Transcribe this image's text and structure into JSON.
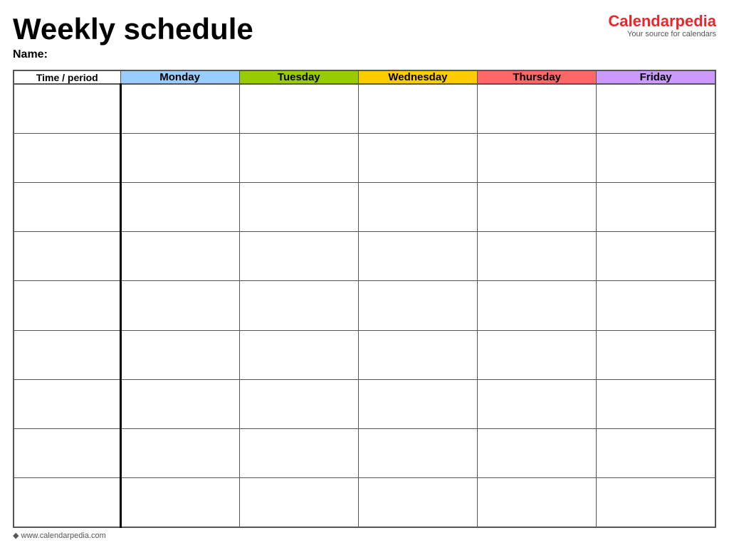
{
  "title": "Weekly schedule",
  "name_label": "Name:",
  "logo": {
    "text_before": "Calendar",
    "text_accent": "pedia",
    "subtitle": "Your source for calendars"
  },
  "columns": {
    "time_period": "Time / period",
    "monday": "Monday",
    "tuesday": "Tuesday",
    "wednesday": "Wednesday",
    "thursday": "Thursday",
    "friday": "Friday"
  },
  "rows": 9,
  "footer": "www.calendarpedia.com"
}
